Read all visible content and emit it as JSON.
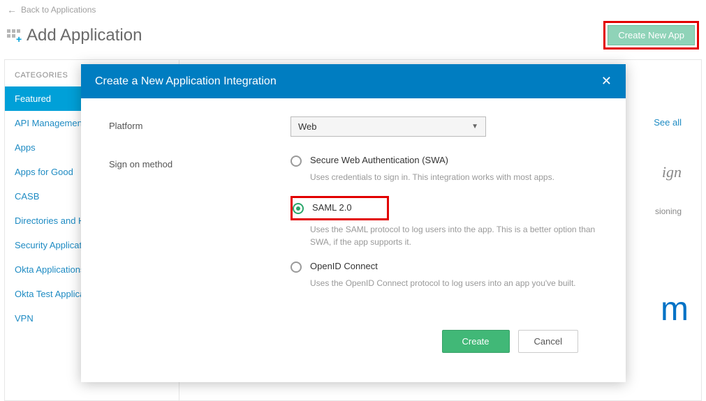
{
  "back_link": "Back to Applications",
  "page_title": "Add Application",
  "create_new_app": "Create New App",
  "sidebar": {
    "heading": "CATEGORIES",
    "items": [
      "Featured",
      "API Management",
      "Apps",
      "Apps for Good",
      "CASB",
      "Directories and HR",
      "Security Applications",
      "Okta Applications",
      "Okta Test Applications",
      "VPN"
    ]
  },
  "see_all": "See all",
  "partial1": "ign",
  "partial2": "sioning",
  "partial3": "m",
  "modal": {
    "title": "Create a New Application Integration",
    "close": "✕",
    "platform_label": "Platform",
    "platform_value": "Web",
    "signon_label": "Sign on method",
    "options": {
      "swa": {
        "label": "Secure Web Authentication (SWA)",
        "desc": "Uses credentials to sign in. This integration works with most apps."
      },
      "saml": {
        "label": "SAML 2.0",
        "desc": "Uses the SAML protocol to log users into the app. This is a better option than SWA, if the app supports it."
      },
      "oidc": {
        "label": "OpenID Connect",
        "desc": "Uses the OpenID Connect protocol to log users into an app you've built."
      }
    },
    "create_btn": "Create",
    "cancel_btn": "Cancel"
  }
}
